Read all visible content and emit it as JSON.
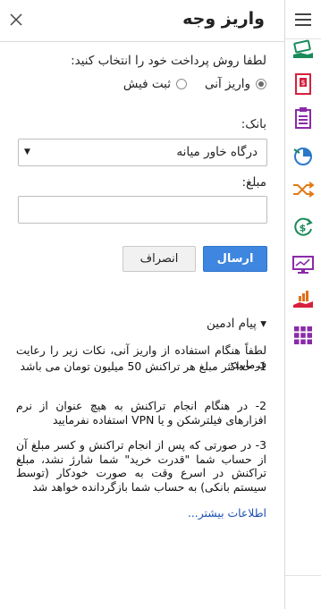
{
  "panel": {
    "title": "واریز وجه",
    "close_icon": "close-icon"
  },
  "form": {
    "prompt": "لطفا روش پرداخت خود را انتخاب کنید:",
    "methods": [
      {
        "label": "واریز آنی",
        "checked": true
      },
      {
        "label": "ثبت فیش",
        "checked": false
      }
    ],
    "bank_label": "بانک:",
    "bank_selected": "درگاه خاور میانه",
    "amount_label": "مبلغ:",
    "amount_value": "",
    "submit_label": "ارسال",
    "cancel_label": "انصراف"
  },
  "admin": {
    "toggle_label": "▾ پیام ادمین",
    "intro": "لطفاً هنگام استفاده از واریز آنی، نکات زیر را رعایت فرمایید:",
    "notes": [
      "1- حداکثر مبلغ هر تراکنش 50 میلیون تومان می باشد",
      "2- در هنگام انجام تراکنش به هیچ عنوان از نرم افزارهای فیلترشکن و یا VPN استفاده نفرمایید",
      "3- در صورتی که پس از انجام تراکنش و کسر مبلغ آن از حساب شما \"قدرت خرید\" شما شارژ نشد، مبلغ تراکنش در اسرع وقت به صورت خودکار (توسط سیستم بانکی) به حساب شما بازگردانده خواهد شد"
    ],
    "more_link": "اطلاعات بیشتر..."
  },
  "sidebar": {
    "items": [
      {
        "icon": "menu-icon",
        "color": "#444444"
      },
      {
        "icon": "deposit-hand-icon",
        "color": "#1b8a5a"
      },
      {
        "icon": "receipt-icon",
        "color": "#d6203d"
      },
      {
        "icon": "clipboard-icon",
        "color": "#8a2aa8"
      },
      {
        "icon": "pie-chart-icon",
        "color": "#2a78c8"
      },
      {
        "icon": "shuffle-icon",
        "color": "#e07a14"
      },
      {
        "icon": "refund-dollar-icon",
        "color": "#1b8a5a"
      },
      {
        "icon": "monitor-chart-icon",
        "color": "#8a2aa8"
      },
      {
        "icon": "hand-chart-icon",
        "color": "#e0701a"
      },
      {
        "icon": "apps-grid-icon",
        "color": "#8a2aa8"
      }
    ]
  }
}
